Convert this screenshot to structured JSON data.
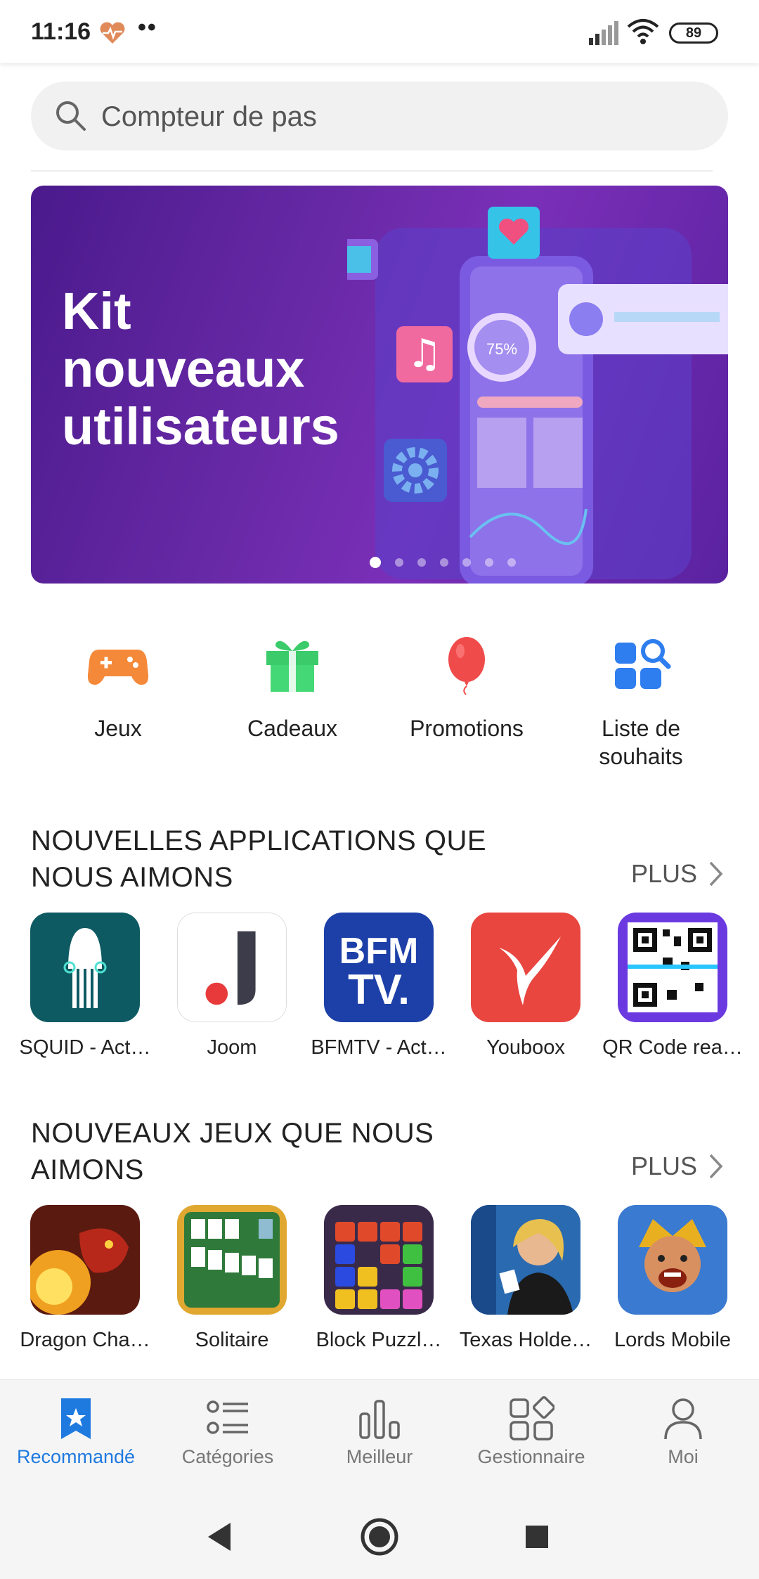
{
  "status_bar": {
    "time": "11:16",
    "dots": "••",
    "battery": "89"
  },
  "search": {
    "placeholder": "Compteur de pas"
  },
  "banner": {
    "title": "Kit nouveaux utilisateurs",
    "art_percent": "75%",
    "slide_count": 7,
    "active_slide": 0
  },
  "shortcuts": [
    {
      "label": "Jeux",
      "icon": "gamepad-icon"
    },
    {
      "label": "Cadeaux",
      "icon": "gift-icon"
    },
    {
      "label": "Promotions",
      "icon": "balloon-icon"
    },
    {
      "label": "Liste de souhaits",
      "icon": "wishlist-icon"
    }
  ],
  "apps_section": {
    "title": "NOUVELLES APPLICATIONS QUE NOUS AIMONS",
    "plus": "PLUS",
    "items": [
      {
        "name": "SQUID - Act…",
        "icon": "squid-app-icon"
      },
      {
        "name": "Joom",
        "icon": "joom-app-icon"
      },
      {
        "name": "BFMTV - Act…",
        "icon": "bfmtv-app-icon"
      },
      {
        "name": "Youboox",
        "icon": "youboox-app-icon"
      },
      {
        "name": "QR Code rea…",
        "icon": "qr-code-app-icon"
      }
    ]
  },
  "games_section": {
    "title": "NOUVEAUX JEUX QUE NOUS AIMONS",
    "plus": "PLUS",
    "items": [
      {
        "name": "Dragon Cha…",
        "icon": "dragon-game-icon"
      },
      {
        "name": "Solitaire",
        "icon": "solitaire-game-icon"
      },
      {
        "name": "Block Puzzl…",
        "icon": "block-puzzle-game-icon"
      },
      {
        "name": "Texas Holde…",
        "icon": "poker-game-icon"
      },
      {
        "name": "Lords Mobile",
        "icon": "lords-mobile-game-icon"
      }
    ]
  },
  "bottom_nav": [
    {
      "label": "Recommandé",
      "active": true
    },
    {
      "label": "Catégories",
      "active": false
    },
    {
      "label": "Meilleur",
      "active": false
    },
    {
      "label": "Gestionnaire",
      "active": false
    },
    {
      "label": "Moi",
      "active": false
    }
  ],
  "colors": {
    "accent": "#1f7ae0",
    "banner": "#6a2aa8"
  }
}
